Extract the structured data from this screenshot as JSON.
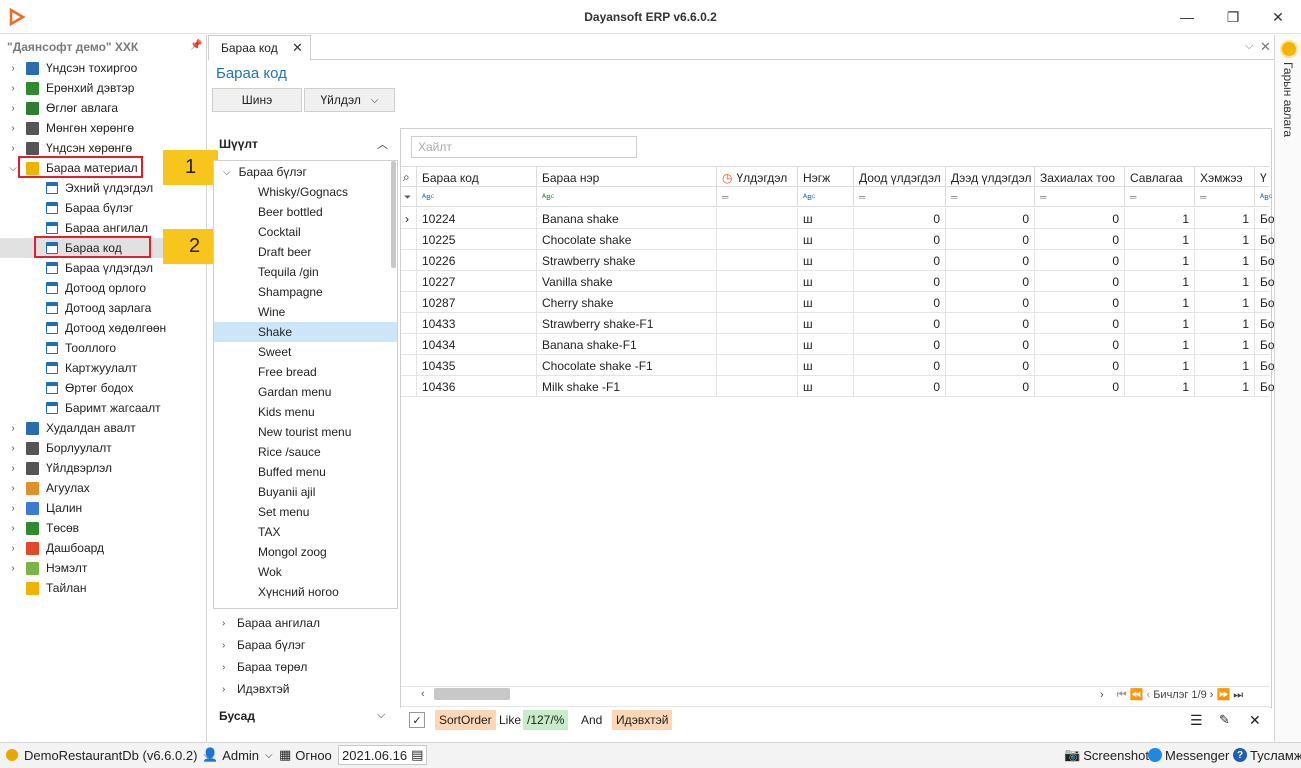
{
  "window": {
    "title": "Dayansoft ERP v6.6.0.2"
  },
  "nav": {
    "company": "\"Даянсофт демо\" ХХК",
    "items": [
      {
        "label": "Үндсэн тохиргоо",
        "icon": "settings-grid-icon",
        "color": "#2b6cb0"
      },
      {
        "label": "Ерөнхий дэвтэр",
        "icon": "ledger-book-icon",
        "color": "#2e8b2e"
      },
      {
        "label": "Өглөг авлага",
        "icon": "dollar-doc-icon",
        "color": "#2e7d32"
      },
      {
        "label": "Мөнгөн хөрөнгө",
        "icon": "bank-icon",
        "color": "#555555"
      },
      {
        "label": "Үндсэн хөрөнгө",
        "icon": "building-icon",
        "color": "#555555"
      },
      {
        "label": "Бараа материал",
        "icon": "box-icon",
        "color": "#f0b400"
      },
      {
        "label": "Эхний үлдэгдэл",
        "icon": "form-icon",
        "sub": true
      },
      {
        "label": "Бараа бүлэг",
        "icon": "form-icon",
        "sub": true
      },
      {
        "label": "Бараа ангилал",
        "icon": "form-icon",
        "sub": true
      },
      {
        "label": "Бараа код",
        "icon": "form-icon",
        "sub": true
      },
      {
        "label": "Бараа үлдэгдэл",
        "icon": "form-icon",
        "sub": true
      },
      {
        "label": "Дотоод орлого",
        "icon": "form-icon",
        "sub": true
      },
      {
        "label": "Дотоод зарлага",
        "icon": "form-icon",
        "sub": true
      },
      {
        "label": "Дотоод хөдөлгөөн",
        "icon": "form-icon",
        "sub": true
      },
      {
        "label": "Тооллого",
        "icon": "form-icon",
        "sub": true
      },
      {
        "label": "Картжуулалт",
        "icon": "form-icon",
        "sub": true
      },
      {
        "label": "Өртөг бодох",
        "icon": "form-icon",
        "sub": true
      },
      {
        "label": "Баримт жагсаалт",
        "icon": "form-icon",
        "sub": true
      },
      {
        "label": "Худалдан авалт",
        "icon": "truck-icon",
        "color": "#2b6cb0"
      },
      {
        "label": "Борлуулалт",
        "icon": "bar-chart-icon",
        "color": "#555555"
      },
      {
        "label": "Үйлдвэрлэл",
        "icon": "factory-icon",
        "color": "#555555"
      },
      {
        "label": "Агуулах",
        "icon": "warehouse-grid-icon",
        "color": "#e0902a"
      },
      {
        "label": "Цалин",
        "icon": "payroll-icon",
        "color": "#3a7bd5"
      },
      {
        "label": "Төсөв",
        "icon": "budget-chart-icon",
        "color": "#2e8b2e"
      },
      {
        "label": "Дашбоард",
        "icon": "pie-chart-icon",
        "color": "#e04a2a"
      },
      {
        "label": "Нэмэлт",
        "icon": "puzzle-icon",
        "color": "#7cb342"
      },
      {
        "label": "Тайлан",
        "icon": "clipboard-icon",
        "color": "#f0b400"
      }
    ],
    "annotations": [
      "1",
      "2"
    ]
  },
  "tabs": {
    "active": "Бараа код"
  },
  "page": {
    "title": "Бараа код",
    "new_btn": "Шинэ",
    "action_btn": "Үйлдэл"
  },
  "right_panel": {
    "label": "Гарын авлага"
  },
  "filter": {
    "title": "Шүүлт",
    "root": "Бараа бүлэг",
    "groups": [
      "Whisky/Gognacs",
      "Beer bottled",
      "Cocktail",
      "Draft beer",
      "Tequila /gin",
      "Shampagne",
      "Wine",
      "Shake",
      "Sweet",
      "Free bread",
      "Gardan menu",
      "Kids menu",
      "New tourist menu",
      "Rice /sauce",
      "Buffed menu",
      "Buyanii ajil",
      "Set menu",
      "TAX",
      "Mongol zoog",
      "Wok",
      "Хүнсний ногоо"
    ],
    "selected": "Shake",
    "sections": [
      "Бараа ангилал",
      "Бараа бүлэг",
      "Бараа төрөл",
      "Идэвхтэй"
    ],
    "other": "Бусад"
  },
  "grid": {
    "search_placeholder": "Хайлт",
    "columns": [
      "Бараа код",
      "Бараа нэр",
      "Үлдэгдэл",
      "Нэгж",
      "Доод үлдэгдэл",
      "Дээд үлдэгдэл",
      "Захиалах тоо",
      "Савлагаа",
      "Хэмжээ",
      "Ү"
    ],
    "rows": [
      {
        "code": "10224",
        "name": "Banana shake",
        "unit": "ш",
        "min": "0",
        "max": "0",
        "order": "0",
        "pack": "1",
        "size": "1",
        "extra": "Бо"
      },
      {
        "code": "10225",
        "name": "Chocolate shake",
        "unit": "ш",
        "min": "0",
        "max": "0",
        "order": "0",
        "pack": "1",
        "size": "1",
        "extra": "Бо"
      },
      {
        "code": "10226",
        "name": "Strawberry shake",
        "unit": "ш",
        "min": "0",
        "max": "0",
        "order": "0",
        "pack": "1",
        "size": "1",
        "extra": "Бо"
      },
      {
        "code": "10227",
        "name": "Vanilla shake",
        "unit": "ш",
        "min": "0",
        "max": "0",
        "order": "0",
        "pack": "1",
        "size": "1",
        "extra": "Бо"
      },
      {
        "code": "10287",
        "name": "Cherry shake",
        "unit": "ш",
        "min": "0",
        "max": "0",
        "order": "0",
        "pack": "1",
        "size": "1",
        "extra": "Бо"
      },
      {
        "code": "10433",
        "name": "Strawberry shake-F1",
        "unit": "ш",
        "min": "0",
        "max": "0",
        "order": "0",
        "pack": "1",
        "size": "1",
        "extra": "Бо"
      },
      {
        "code": "10434",
        "name": "Banana shake-F1",
        "unit": "ш",
        "min": "0",
        "max": "0",
        "order": "0",
        "pack": "1",
        "size": "1",
        "extra": "Бо"
      },
      {
        "code": "10435",
        "name": "Chocolate shake -F1",
        "unit": "ш",
        "min": "0",
        "max": "0",
        "order": "0",
        "pack": "1",
        "size": "1",
        "extra": "Бо"
      },
      {
        "code": "10436",
        "name": "Milk shake -F1",
        "unit": "ш",
        "min": "0",
        "max": "0",
        "order": "0",
        "pack": "1",
        "size": "1",
        "extra": "Бо"
      }
    ],
    "pager": "Бичлэг 1/9",
    "filter_expr": {
      "field": "SortOrder",
      "op": "Like",
      "value": "/127/%",
      "joiner": "And",
      "field2": "Идэвхтэй"
    }
  },
  "status": {
    "db": "DemoRestaurantDb (v6.6.0.2)",
    "user": "Admin",
    "day_label": "Огноо",
    "date": "2021.06.16",
    "screenshot": "Screenshot",
    "messenger": "Messenger",
    "help": "Тусламж"
  }
}
